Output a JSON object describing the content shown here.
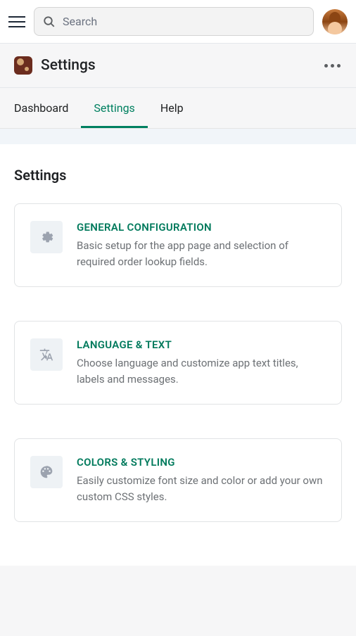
{
  "search": {
    "placeholder": "Search"
  },
  "header": {
    "title": "Settings"
  },
  "tabs": [
    {
      "label": "Dashboard",
      "active": false
    },
    {
      "label": "Settings",
      "active": true
    },
    {
      "label": "Help",
      "active": false
    }
  ],
  "content": {
    "title": "Settings",
    "cards": [
      {
        "icon": "gear",
        "title": "GENERAL CONFIGURATION",
        "description": "Basic setup for the app page and selection of required order lookup fields."
      },
      {
        "icon": "language",
        "title": "LANGUAGE & TEXT",
        "description": "Choose language and customize app text titles, labels and messages."
      },
      {
        "icon": "palette",
        "title": "COLORS & STYLING",
        "description": "Easily customize font size and color or add your own custom CSS styles."
      }
    ]
  },
  "colors": {
    "accent": "#008060",
    "text_primary": "#1f2124",
    "text_secondary": "#6d7175"
  }
}
